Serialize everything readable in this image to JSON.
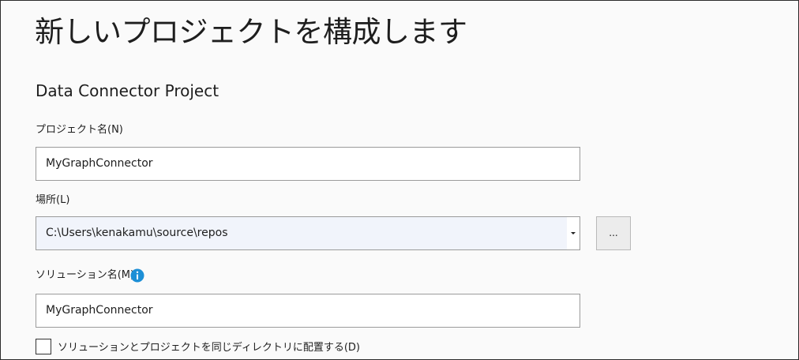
{
  "header": {
    "title": "新しいプロジェクトを構成します",
    "subtitle": "Data Connector Project"
  },
  "form": {
    "project_name": {
      "label": "プロジェクト名(N)",
      "value": "MyGraphConnector"
    },
    "location": {
      "label": "場所(L)",
      "value": "C:\\Users\\kenakamu\\source\\repos",
      "browse_label": "..."
    },
    "solution_name": {
      "label": "ソリューション名(M)",
      "value": "MyGraphConnector",
      "info_icon": "info-icon"
    },
    "same_directory": {
      "label": "ソリューションとプロジェクトを同じディレクトリに配置する(D)",
      "checked": false
    }
  },
  "colors": {
    "background": "#fafafa",
    "info_accent": "#1d8fd6",
    "text": "#1e1e1e",
    "field_border": "#9b9b9b"
  }
}
